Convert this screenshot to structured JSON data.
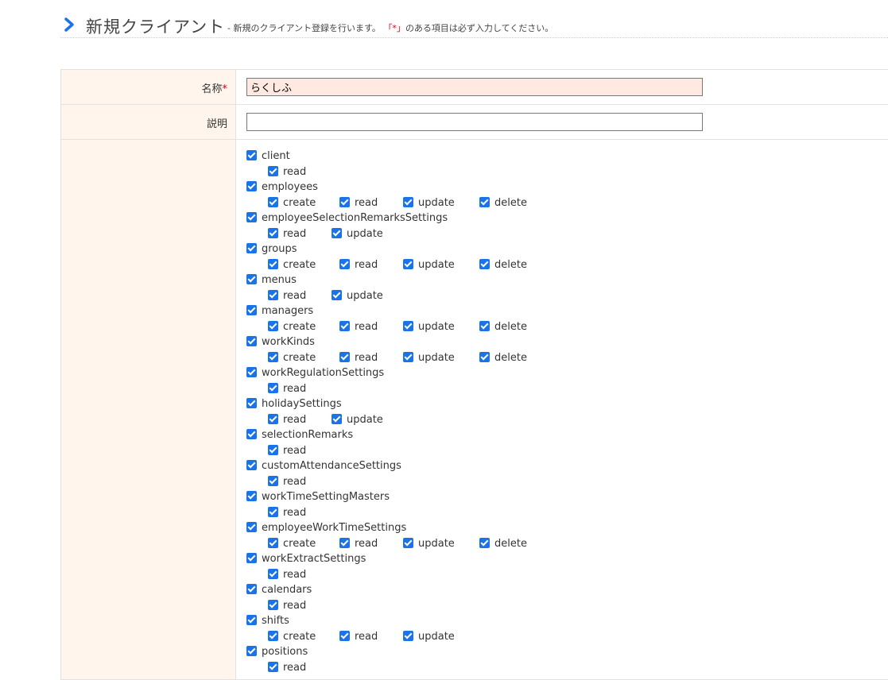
{
  "header": {
    "title": "新規クライアント",
    "subtitle_prefix": "- 新規のクライアント登録を行います。",
    "subtitle_mark": "「*」",
    "subtitle_suffix": "のある項目は必ず入力してください。",
    "chevron_color": "#1a73e8"
  },
  "form": {
    "name_label": "名称",
    "required_mark": "*",
    "name_value": "らくしふ",
    "description_label": "説明",
    "description_value": ""
  },
  "permissions": [
    {
      "name": "client",
      "ops": [
        "read"
      ]
    },
    {
      "name": "employees",
      "ops": [
        "create",
        "read",
        "update",
        "delete"
      ]
    },
    {
      "name": "employeeSelectionRemarksSettings",
      "ops": [
        "read",
        "update"
      ]
    },
    {
      "name": "groups",
      "ops": [
        "create",
        "read",
        "update",
        "delete"
      ]
    },
    {
      "name": "menus",
      "ops": [
        "read",
        "update"
      ]
    },
    {
      "name": "managers",
      "ops": [
        "create",
        "read",
        "update",
        "delete"
      ]
    },
    {
      "name": "workKinds",
      "ops": [
        "create",
        "read",
        "update",
        "delete"
      ]
    },
    {
      "name": "workRegulationSettings",
      "ops": [
        "read"
      ]
    },
    {
      "name": "holidaySettings",
      "ops": [
        "read",
        "update"
      ]
    },
    {
      "name": "selectionRemarks",
      "ops": [
        "read"
      ]
    },
    {
      "name": "customAttendanceSettings",
      "ops": [
        "read"
      ]
    },
    {
      "name": "workTimeSettingMasters",
      "ops": [
        "read"
      ]
    },
    {
      "name": "employeeWorkTimeSettings",
      "ops": [
        "create",
        "read",
        "update",
        "delete"
      ]
    },
    {
      "name": "workExtractSettings",
      "ops": [
        "read"
      ]
    },
    {
      "name": "calendars",
      "ops": [
        "read"
      ]
    },
    {
      "name": "shifts",
      "ops": [
        "create",
        "read",
        "update"
      ]
    },
    {
      "name": "positions",
      "ops": [
        "read"
      ]
    }
  ],
  "checkbox_color": "#1a73e8"
}
